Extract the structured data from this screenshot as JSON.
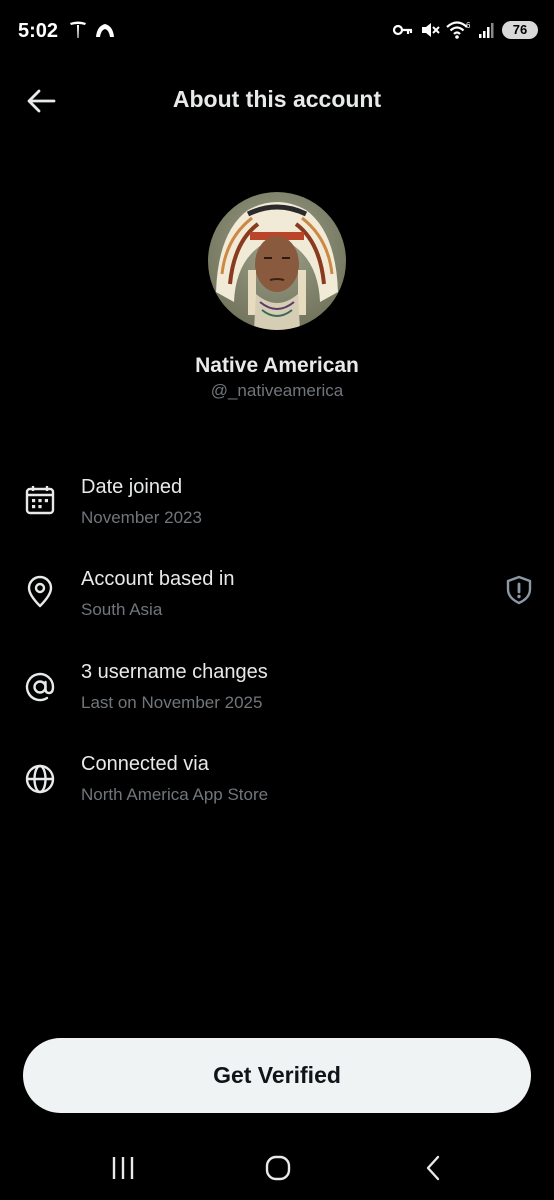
{
  "status_bar": {
    "time": "5:02",
    "battery": "76",
    "wifi_label": "6",
    "icons": [
      "tesla-icon",
      "cloud-icon",
      "key-icon",
      "mute-icon",
      "wifi-icon",
      "signal-icon",
      "battery-icon"
    ]
  },
  "header": {
    "title": "About this account",
    "back_icon": "arrow-left-icon"
  },
  "profile": {
    "name": "Native American",
    "handle": "@_nativeamerica"
  },
  "rows": [
    {
      "icon": "calendar-icon",
      "title": "Date joined",
      "subtitle": "November 2023"
    },
    {
      "icon": "location-pin-icon",
      "title": "Account based in",
      "subtitle": "South Asia",
      "trailing_icon": "shield-alert-icon"
    },
    {
      "icon": "at-sign-icon",
      "title": "3 username changes",
      "subtitle": "Last on November 2025"
    },
    {
      "icon": "globe-icon",
      "title": "Connected via",
      "subtitle": "North America App Store"
    }
  ],
  "button": {
    "label": "Get Verified"
  },
  "nav_bar": {
    "buttons": [
      "recents-icon",
      "home-icon",
      "back-icon"
    ]
  },
  "colors": {
    "background": "#000000",
    "primary_text": "#e7e9ea",
    "secondary_text": "#71767b",
    "button_bg": "#eff3f4",
    "button_text": "#0f1419"
  }
}
